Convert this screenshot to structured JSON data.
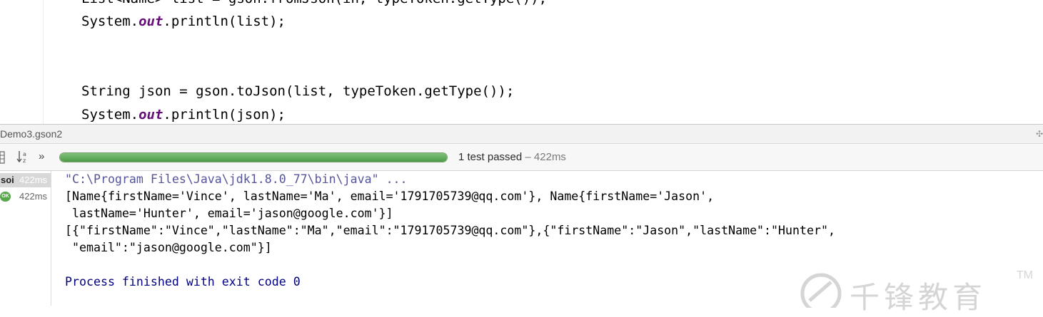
{
  "editor": {
    "lines": [
      "List<Name> list = gson.fromJson(in, typeToken.getType());",
      "System.",
      "out",
      ".println(list);",
      "String json = gson.toJson(list, typeToken.getType());",
      "System.",
      "out",
      ".println(json);"
    ]
  },
  "run_panel": {
    "title": "Demo3.gson2",
    "toolbar": {
      "sort_icon": "sort-icon",
      "more_icon": "double-chevron-icon",
      "more_label": "»"
    },
    "progress": {
      "percent": 100,
      "color": "#59a84e"
    },
    "status": {
      "passed": "1 test passed",
      "duration": " – 422ms"
    },
    "tree": [
      {
        "name": "soi",
        "time": "422ms",
        "selected": true
      },
      {
        "badge": "OK",
        "time": "422ms",
        "selected": false
      }
    ]
  },
  "console": {
    "lines": [
      "\"C:\\Program Files\\Java\\jdk1.8.0_77\\bin\\java\" ...",
      "[Name{firstName='Vince', lastName='Ma', email='1791705739@qq.com'}, Name{firstName='Jason',",
      " lastName='Hunter', email='jason@google.com'}]",
      "[{\"firstName\":\"Vince\",\"lastName\":\"Ma\",\"email\":\"1791705739@qq.com\"},{\"firstName\":\"Jason\",\"lastName\":\"Hunter\",",
      " \"email\":\"jason@google.com\"}]",
      "Process finished with exit code 0"
    ]
  },
  "watermark": {
    "text": "千锋教育",
    "tm": "TM"
  }
}
